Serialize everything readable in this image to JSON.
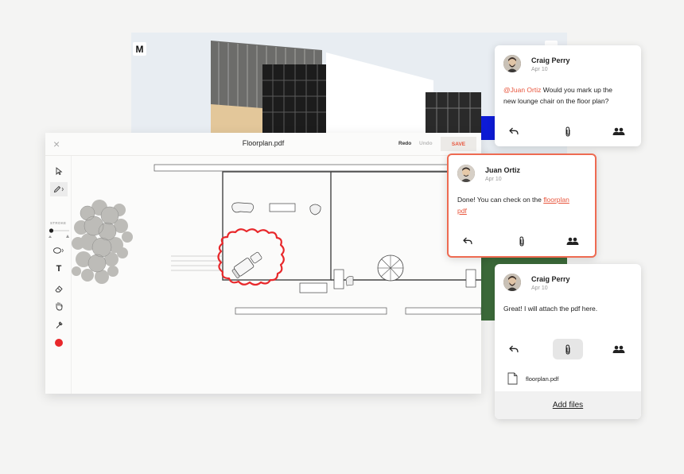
{
  "photo": {
    "badge": "M"
  },
  "editor": {
    "title": "Floorplan.pdf",
    "redo_label": "Redo",
    "undo_label": "Undo",
    "save_label": "SAVE",
    "stroke_label": "STROKE",
    "text_tool_glyph": "T",
    "close_glyph": "×",
    "accent_color": "#e8553c",
    "markup_color": "#e8282b"
  },
  "comments": [
    {
      "author": "Craig Perry",
      "date": "Apr 10",
      "mention": "@Juan Ortiz",
      "text_line1": " Would you mark up the",
      "text_line2": "new lounge chair on the floor plan?"
    },
    {
      "author": "Juan Ortiz",
      "date": "Apr 10",
      "text_before_link": "Done! You can check on the ",
      "link_part1": "floorplan",
      "link_part2": "pdf"
    },
    {
      "author": "Craig Perry",
      "date": "Apr 10",
      "text": "Great! I will attach the pdf here.",
      "attachment_name": "floorplan.pdf",
      "add_files_label": "Add files"
    }
  ],
  "icons": {
    "reply": "reply-icon",
    "attach": "paperclip-icon",
    "users": "users-icon",
    "file": "file-icon"
  }
}
